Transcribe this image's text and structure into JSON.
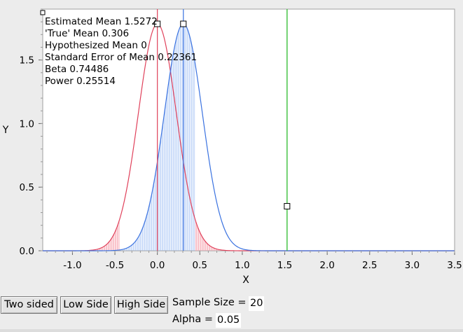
{
  "stats": {
    "estimated_mean": "Estimated Mean 1.5272",
    "true_mean": "'True' Mean 0.306",
    "hypothesized_mean": "Hypothesized Mean 0",
    "std_error": "Standard Error of Mean 0.22361",
    "beta": "Beta 0.74486",
    "power": "Power 0.25514"
  },
  "buttons": {
    "two_sided": "Two sided",
    "low_side": "Low Side",
    "high_side": "High Side"
  },
  "controls": {
    "sample_size_label": "Sample Size =",
    "sample_size_value": "20",
    "alpha_label": "Alpha =",
    "alpha_value": "0.05"
  },
  "chart_data": {
    "type": "line",
    "xlabel": "X",
    "ylabel": "Y",
    "xlim": [
      -1.35,
      3.5
    ],
    "ylim": [
      0,
      1.9
    ],
    "x_ticks": [
      "-1.0",
      "-0.5",
      "0.0",
      "0.5",
      "1.0",
      "1.5",
      "2.0",
      "2.5",
      "3.0",
      "3.5"
    ],
    "x_tick_values": [
      -1.0,
      -0.5,
      0.0,
      0.5,
      1.0,
      1.5,
      2.0,
      2.5,
      3.0,
      3.5
    ],
    "y_ticks": [
      "0.0",
      "0.5",
      "1.0",
      "1.5"
    ],
    "y_tick_values": [
      0.0,
      0.5,
      1.0,
      1.5
    ],
    "hypothesized_mean": 0,
    "true_mean": 0.306,
    "estimated_mean": 1.5272,
    "std_error": 0.22361,
    "critical_low": -0.4383,
    "critical_high": 0.4383,
    "series": [
      {
        "type": "normal-curve",
        "mean": 0,
        "sd": 0.22361
      },
      {
        "type": "normal-curve",
        "mean": 0.306,
        "sd": 0.22361
      }
    ],
    "handles": [
      {
        "x": 0.0,
        "y": 1.784
      },
      {
        "x": 0.306,
        "y": 1.784
      },
      {
        "x": 1.5272,
        "y": 0.35
      }
    ],
    "colors": {
      "null_curve": "#e0405a",
      "null_fill": "#f6a0ac",
      "alt_curve": "#3a72e0",
      "alt_fill": "#8fb4f2",
      "alt_fill_light": "#cfdcf8",
      "estimate_line": "#3ac03a"
    },
    "grid": false
  }
}
